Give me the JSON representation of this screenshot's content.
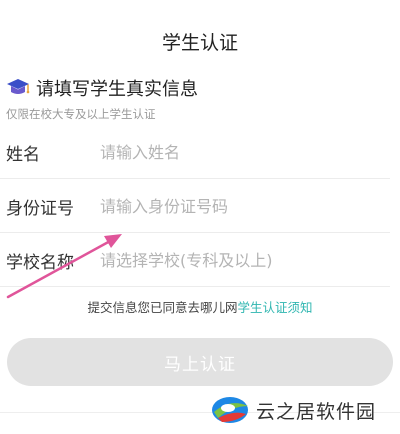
{
  "header": {
    "title": "学生认证"
  },
  "section": {
    "icon": "graduation-cap-icon",
    "title": "请填写学生真实信息",
    "subtitle": "仅限在校大专及以上学生认证"
  },
  "form": {
    "name": {
      "label": "姓名",
      "placeholder": "请输入姓名",
      "value": ""
    },
    "id_number": {
      "label": "身份证号",
      "placeholder": "请输入身份证号码",
      "value": ""
    },
    "school": {
      "label": "学校名称",
      "placeholder": "请选择学校(专科及以上)",
      "value": ""
    }
  },
  "agreement": {
    "text": "提交信息您已同意去哪儿网",
    "link": "学生认证须知"
  },
  "submit": {
    "label": "马上认证"
  },
  "watermark": {
    "text": "云之居软件园"
  },
  "colors": {
    "link": "#2fb6b0",
    "button_disabled": "#e2e2e2",
    "arrow": "#e0559a",
    "cap": "#3b4fc8"
  }
}
